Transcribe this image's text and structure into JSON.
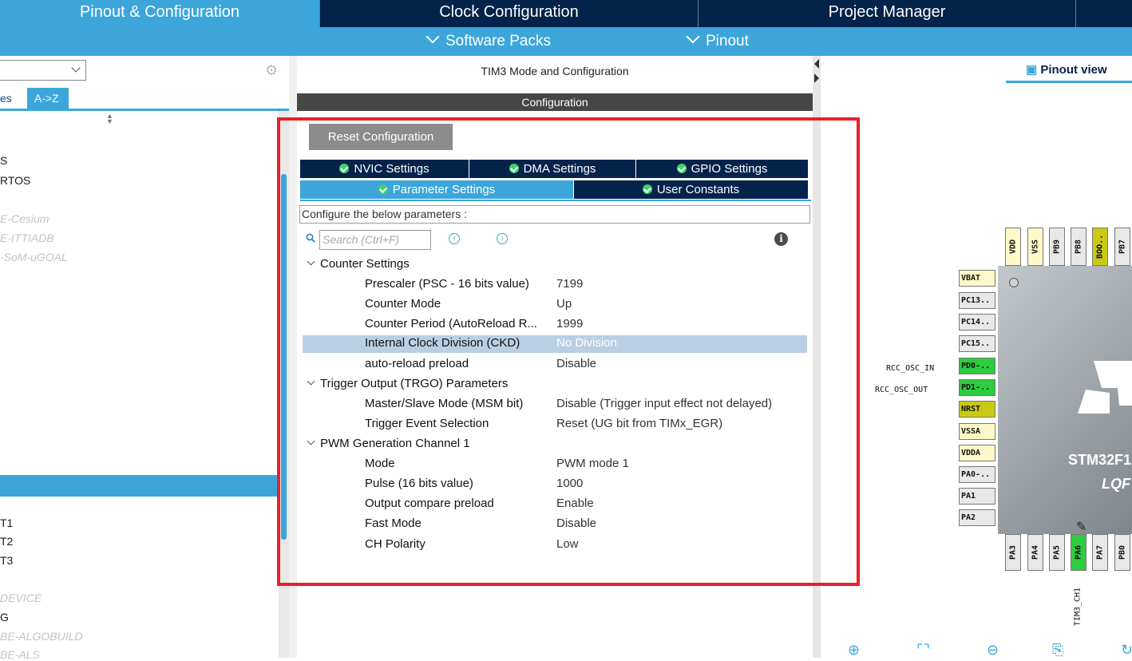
{
  "top_tabs": [
    "Pinout & Configuration",
    "Clock Configuration",
    "Project Manager"
  ],
  "sub_menu": [
    "Software Packs",
    "Pinout"
  ],
  "left_panel": {
    "tab_categories_partial": "es",
    "tab_az": "A->Z",
    "items_top": [
      "S",
      "RTOS"
    ],
    "items_dim": [
      "E-Cesium",
      "E-ITTIADB",
      "-SoM-uGOAL"
    ],
    "items_bottom": [
      "T1",
      "T2",
      "T3"
    ],
    "items_bottom_dim": [
      "DEVICE"
    ],
    "items_bottom2": [
      "G"
    ],
    "items_bottom_dim2": [
      "BE-ALGOBUILD",
      "BE-ALS"
    ]
  },
  "mode_title": "TIM3 Mode and Configuration",
  "config_title": "Configuration",
  "reset_button": "Reset Configuration",
  "config_tabs": {
    "row1": [
      "NVIC Settings",
      "DMA Settings",
      "GPIO Settings"
    ],
    "row2": [
      "Parameter Settings",
      "User Constants"
    ]
  },
  "configure_label": "Configure the below parameters :",
  "search": {
    "placeholder": "Search (Ctrl+F)"
  },
  "groups": [
    {
      "name": "Counter Settings",
      "params": [
        {
          "name": "Prescaler (PSC - 16 bits value)",
          "value": "7199"
        },
        {
          "name": "Counter Mode",
          "value": "Up"
        },
        {
          "name": "Counter Period (AutoReload R...",
          "value": "1999"
        },
        {
          "name": "Internal Clock Division (CKD)",
          "value": "No Division"
        },
        {
          "name": "auto-reload preload",
          "value": "Disable"
        }
      ]
    },
    {
      "name": "Trigger Output (TRGO) Parameters",
      "params": [
        {
          "name": "Master/Slave Mode (MSM bit)",
          "value": "Disable (Trigger input effect not delayed)"
        },
        {
          "name": "Trigger Event Selection",
          "value": "Reset (UG bit from TIMx_EGR)"
        }
      ]
    },
    {
      "name": "PWM Generation Channel 1",
      "params": [
        {
          "name": "Mode",
          "value": "PWM mode 1"
        },
        {
          "name": "Pulse (16 bits value)",
          "value": "1000"
        },
        {
          "name": "Output compare preload",
          "value": "Enable"
        },
        {
          "name": "Fast Mode",
          "value": "Disable"
        },
        {
          "name": "CH Polarity",
          "value": "Low"
        }
      ]
    }
  ],
  "pinout": {
    "view_tab": "Pinout view",
    "chip_name": "STM32F1",
    "chip_package": "LQF",
    "left_pins": [
      {
        "label": "VBAT",
        "color": "#fff8c8"
      },
      {
        "label": "PC13..",
        "color": "#e8e8e8"
      },
      {
        "label": "PC14..",
        "color": "#e8e8e8"
      },
      {
        "label": "PC15..",
        "color": "#e8e8e8"
      },
      {
        "label": "PD0-..",
        "color": "#2ecc40"
      },
      {
        "label": "PD1-..",
        "color": "#2ecc40"
      },
      {
        "label": "NRST",
        "color": "#c9c916"
      },
      {
        "label": "VSSA",
        "color": "#fff8c8"
      },
      {
        "label": "VDDA",
        "color": "#fff8c8"
      },
      {
        "label": "PA0-..",
        "color": "#e8e8e8"
      },
      {
        "label": "PA1",
        "color": "#e8e8e8"
      },
      {
        "label": "PA2",
        "color": "#e8e8e8"
      }
    ],
    "top_pins": [
      {
        "label": "VDD",
        "color": "#fff8c8"
      },
      {
        "label": "VSS",
        "color": "#fff8c8"
      },
      {
        "label": "PB9",
        "color": "#e8e8e8"
      },
      {
        "label": "PB8",
        "color": "#e8e8e8"
      },
      {
        "label": "BOO..",
        "color": "#c9c916"
      },
      {
        "label": "PB7",
        "color": "#e8e8e8"
      }
    ],
    "bottom_pins": [
      {
        "label": "PA3",
        "color": "#e8e8e8"
      },
      {
        "label": "PA4",
        "color": "#e8e8e8"
      },
      {
        "label": "PA5",
        "color": "#e8e8e8"
      },
      {
        "label": "PA6",
        "color": "#2ecc40"
      },
      {
        "label": "PA7",
        "color": "#e8e8e8"
      },
      {
        "label": "PB0",
        "color": "#e8e8e8"
      }
    ],
    "signal_labels": [
      "RCC_OSC_IN",
      "RCC_OSC_OUT"
    ],
    "tim_label": "TIM3_CH1"
  },
  "colors": {
    "nav_dark": "#03234b",
    "accent": "#3ca6db",
    "highlight": "#e8202b",
    "green": "#2ecc40"
  }
}
